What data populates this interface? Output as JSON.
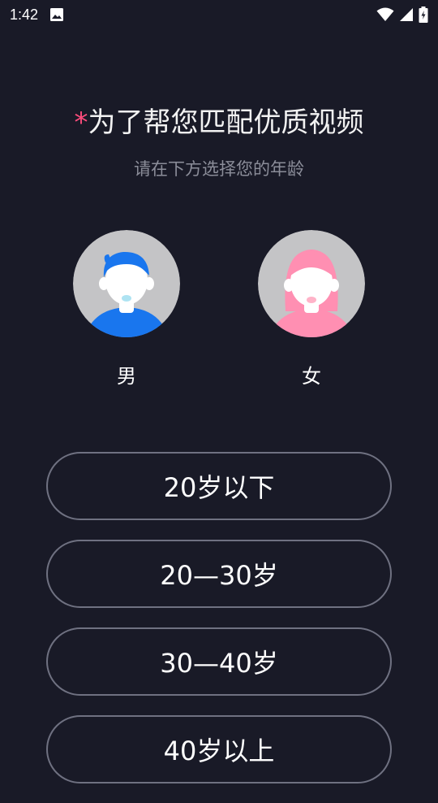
{
  "status_bar": {
    "time": "1:42",
    "icons": [
      "image-icon",
      "wifi-icon",
      "signal-icon",
      "battery-charging-icon"
    ]
  },
  "header": {
    "required_mark": "*",
    "title": "为了帮您匹配优质视频",
    "subtitle": "请在下方选择您的年龄"
  },
  "gender": {
    "male_label": "男",
    "female_label": "女",
    "colors": {
      "male": "#1976ee",
      "female": "#ff8fb2",
      "avatar_bg": "#c4c4c6"
    }
  },
  "age_options": [
    "20岁以下",
    "20—30岁",
    "30—40岁",
    "40岁以上"
  ],
  "colors": {
    "background": "#191a27",
    "accent": "#ff4d7d",
    "border": "#6f7181"
  }
}
